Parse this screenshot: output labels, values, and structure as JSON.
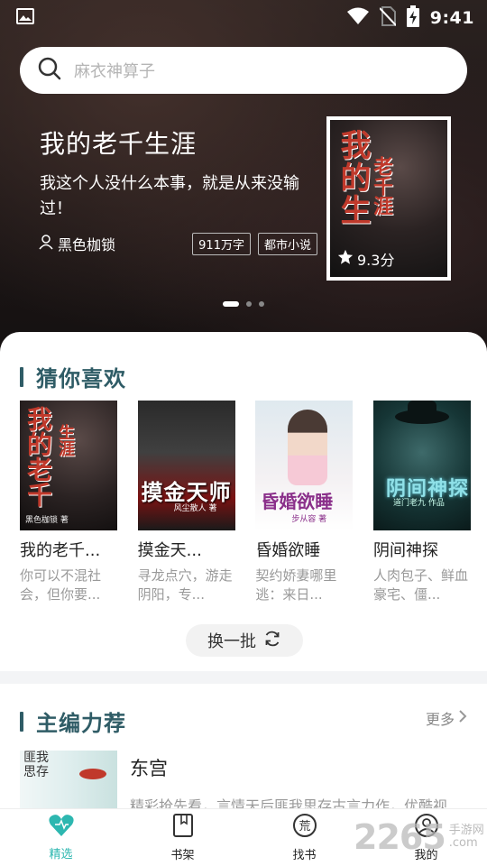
{
  "status_bar": {
    "time": "9:41",
    "icons": [
      "image-icon",
      "wifi-icon",
      "no-sim-icon",
      "battery-charging-icon"
    ]
  },
  "search": {
    "placeholder": "麻衣神算子"
  },
  "hero": {
    "title": "我的老千生涯",
    "description": "我这个人没什么本事，就是从来没输过！",
    "author": "黑色枷锁",
    "tags": [
      "911万字",
      "都市小说"
    ],
    "rating": "9.3分",
    "cover_text_main": "我的生",
    "cover_text_sub": "老千涯",
    "carousel_count": 3,
    "carousel_active": 0
  },
  "guess": {
    "title": "猜你喜欢",
    "books": [
      {
        "title": "我的老千...",
        "desc": "你可以不混社会，但你要...",
        "cover_text": "我的老千",
        "cover_sub": "生涯",
        "cover_small": "黑色枷锁 著"
      },
      {
        "title": "摸金天...",
        "desc": "寻龙点穴，游走阴阳，专...",
        "cover_text": "摸金天师",
        "cover_small": "风尘散人 著"
      },
      {
        "title": "昏婚欲睡",
        "desc": "契约娇妻哪里逃：来日...",
        "cover_text": "昏婚欲睡",
        "cover_small": "步从容 著"
      },
      {
        "title": "阴间神探",
        "desc": "人肉包子、鲜血豪宅、僵...",
        "cover_text": "阴间神探",
        "cover_small": "道门老九 作品"
      }
    ],
    "refresh_label": "换一批"
  },
  "editor": {
    "title": "主编力荐",
    "more_label": "更多",
    "book": {
      "title": "东宫",
      "desc": "精彩抢先看，言情天后匪我思存古言力作，优酷视",
      "cover_text": "匪我思存"
    }
  },
  "nav": [
    {
      "label": "精选",
      "icon": "heart-icon",
      "active": true
    },
    {
      "label": "书架",
      "icon": "bookshelf-icon",
      "active": false
    },
    {
      "label": "找书",
      "icon": "find-book-icon",
      "active": false
    },
    {
      "label": "我的",
      "icon": "profile-icon",
      "active": false
    }
  ],
  "watermark": {
    "number": "2265",
    "text_line1": "手游网",
    "text_line2": ".com"
  },
  "colors": {
    "accent": "#2f5c66",
    "nav_active": "#2db7b0",
    "muted": "#999999"
  }
}
